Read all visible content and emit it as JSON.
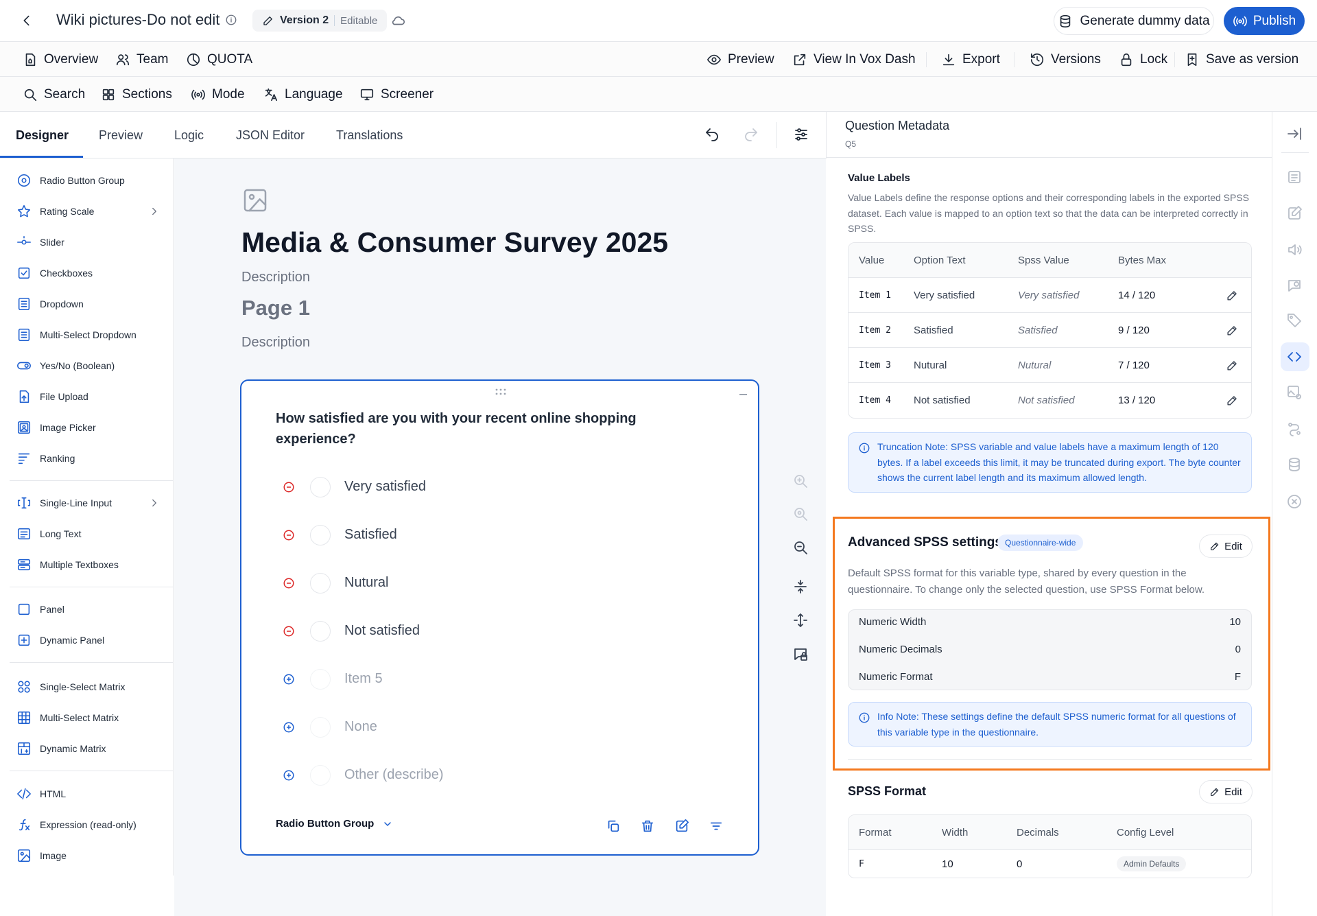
{
  "topbar": {
    "title": "Wiki pictures-Do not edit",
    "version_label": "Version 2",
    "version_state": "Editable",
    "generate_label": "Generate dummy data",
    "publish_label": "Publish"
  },
  "nav1": {
    "overview": "Overview",
    "team": "Team",
    "quota": "QUOTA",
    "preview": "Preview",
    "view_vox": "View In Vox Dash",
    "export": "Export",
    "versions": "Versions",
    "lock": "Lock",
    "save_version": "Save as version"
  },
  "nav2": {
    "search": "Search",
    "sections": "Sections",
    "mode": "Mode",
    "language": "Language",
    "screener": "Screener"
  },
  "tabs": [
    "Designer",
    "Preview",
    "Logic",
    "JSON Editor",
    "Translations"
  ],
  "toolbox": {
    "items": [
      "Radio Button Group",
      "Rating Scale",
      "Slider",
      "Checkboxes",
      "Dropdown",
      "Multi-Select Dropdown",
      "Yes/No (Boolean)",
      "File Upload",
      "Image Picker",
      "Ranking",
      "Single-Line Input",
      "Long Text",
      "Multiple Textboxes",
      "Panel",
      "Dynamic Panel",
      "Single-Select Matrix",
      "Multi-Select Matrix",
      "Dynamic Matrix",
      "HTML",
      "Expression (read-only)",
      "Image"
    ]
  },
  "survey": {
    "title": "Media & Consumer Survey 2025",
    "description": "Description",
    "page_title": "Page 1",
    "page_description": "Description",
    "question": {
      "text": "How satisfied are you with your recent online shopping experience?",
      "options": [
        "Very satisfied",
        "Satisfied",
        "Nutural",
        "Not satisfied"
      ],
      "ghost_options": [
        "Item 5",
        "None",
        "Other (describe)"
      ],
      "type_label": "Radio Button Group"
    }
  },
  "panel": {
    "title": "Question Metadata",
    "subtitle": "Q5",
    "value_labels": {
      "title": "Value Labels",
      "description": "Value Labels define the response options and their corresponding labels in the exported SPSS dataset. Each value is mapped to an option text so that the data can be interpreted correctly in SPSS.",
      "headers": [
        "Value",
        "Option Text",
        "Spss Value",
        "Bytes Max"
      ],
      "rows": [
        {
          "value": "Item 1",
          "option": "Very satisfied",
          "spss": "Very satisfied",
          "bytes": "14 / 120"
        },
        {
          "value": "Item 2",
          "option": "Satisfied",
          "spss": "Satisfied",
          "bytes": "9 / 120"
        },
        {
          "value": "Item 3",
          "option": "Nutural",
          "spss": "Nutural",
          "bytes": "7 / 120"
        },
        {
          "value": "Item 4",
          "option": "Not satisfied",
          "spss": "Not satisfied",
          "bytes": "13 / 120"
        }
      ],
      "note": "Truncation Note: SPSS variable and value labels have a maximum length of 120 bytes. If a label exceeds this limit, it may be truncated during export. The byte counter shows the current label length and its maximum allowed length."
    },
    "advanced": {
      "title": "Advanced SPSS settings",
      "badge": "Questionnaire-wide",
      "edit_label": "Edit",
      "description": "Default SPSS format for this variable type, shared by every question in the questionnaire. To change only the selected question, use SPSS Format below.",
      "rows": [
        {
          "label": "Numeric Width",
          "value": "10"
        },
        {
          "label": "Numeric Decimals",
          "value": "0"
        },
        {
          "label": "Numeric Format",
          "value": "F"
        }
      ],
      "note": "Info Note: These settings define the default SPSS numeric format for all questions of this variable type in the questionnaire."
    },
    "spss_format": {
      "title": "SPSS Format",
      "edit_label": "Edit",
      "headers": [
        "Format",
        "Width",
        "Decimals",
        "Config Level"
      ],
      "row": {
        "format": "F",
        "width": "10",
        "decimals": "0",
        "config": "Admin Defaults"
      }
    }
  },
  "colors": {
    "accent": "#1d5fd0",
    "highlight": "#f4791f",
    "remove": "#dc2626"
  }
}
